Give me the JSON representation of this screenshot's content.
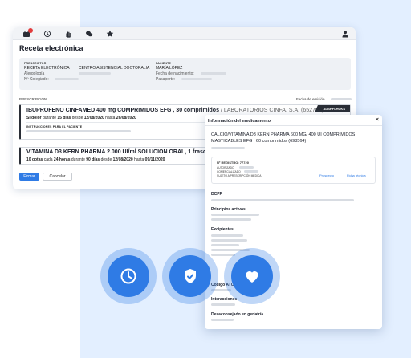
{
  "app": {
    "title": "Receta electrónica",
    "toolbar_icons": [
      "prescription-icon",
      "history-icon",
      "hand-icon",
      "chat-icon",
      "star-icon",
      "user-icon"
    ],
    "prescriptor": {
      "label": "PRESCRIPTOR",
      "name": "RECETA ELECTRÓNICA",
      "center": "CENTRO ASISTENCIAL DOCTORALIA",
      "specialty": "Alergología",
      "colegiado_label": "Nº Colegiado:"
    },
    "paciente": {
      "label": "PACIENTE",
      "name": "MARÍA LÓPEZ",
      "birth_label": "Fecha de nacimiento:",
      "passport_label": "Pasaporte:"
    },
    "prescripcion_label": "PRESCRIPCIÓN",
    "emision_label": "Fecha de emisión",
    "med1": {
      "name": "IBUPROFENO CINFAMED 400 mg COMPRIMIDOS EFG , 30 comprimidos",
      "lab": "/ LABORATORIOS CINFA, S.A. (652798)",
      "tag": "ADSHFLHUKS",
      "dose_pre": "Si dolor",
      "dose_mid": "durante",
      "dose_days": "15 días",
      "dose_from": "desde",
      "date_from": "12/08/2020",
      "dose_until": "hasta",
      "date_until": "26/08/2020",
      "instructions_label": "INSTRUCCIONES PARA EL PACIENTE"
    },
    "med2": {
      "name": "VITAMINA D3 KERN PHARMA 2.000 UI/ml SOLUCION ORAL, 1 frasco de 10 ml",
      "dose_pre": "10 gotas",
      "dose_every": "cada",
      "dose_freq": "24 horas",
      "dose_mid": "durante",
      "dose_days": "90 días",
      "dose_from": "desde",
      "date_from": "12/08/2020",
      "dose_until": "hasta",
      "date_until": "09/11/2020"
    },
    "buttons": {
      "sign": "Firmar",
      "cancel": "Cancelar"
    }
  },
  "modal": {
    "title": "Información del medicamento",
    "close": "×",
    "product": "CALCIO/VITAMINA D3 KERN PHARMA 600 MG/ 400 UI COMPRIMIDOS MASTICABLES EFG , 60 comprimidos (698564)",
    "registro": "Nº REGISTRO: 77720",
    "autorizado": "AUTORIZADO",
    "comercializado": "COMERCIALIZADO",
    "sujeto": "SUJETO A PRESCRIPCIÓN MÉDICA",
    "links": {
      "prospecto": "Prospecto",
      "ficha": "Ficha técnica"
    },
    "sections": [
      "DCPF",
      "Principios activos",
      "Excipientes",
      "Código ATC",
      "Interacciones",
      "Desaconsejado en geriatría"
    ]
  },
  "features": [
    "clock-icon",
    "shield-icon",
    "heart-icon"
  ],
  "colors": {
    "accent": "#2f7be5",
    "background_panel": "#e3efff",
    "tag": "#2a2e36",
    "badge": "#e23b3b"
  }
}
